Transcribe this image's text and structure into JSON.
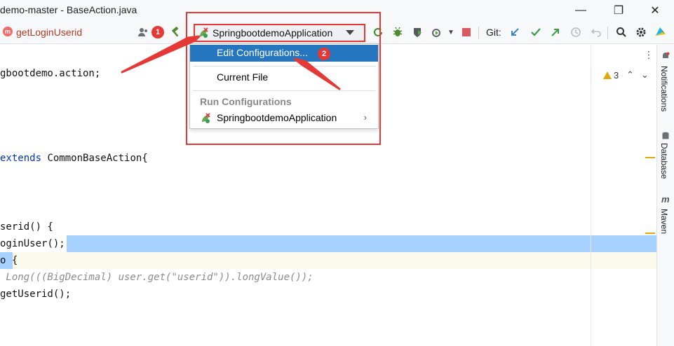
{
  "window": {
    "title": "demo-master - BaseAction.java",
    "min_glyph": "—",
    "restore_glyph": "❐",
    "close_glyph": "✕"
  },
  "toolbar": {
    "method_badge": "m",
    "method_label": "getLoginUserid",
    "run_config_label": "SpringbootdemoApplication",
    "git_label": "Git:"
  },
  "icons": {
    "user": "user-icon",
    "hammer": "hammer-icon",
    "app": "spring-app-icon",
    "rerun": "rerun-icon",
    "debug": "debug-icon",
    "coverage": "coverage-icon",
    "profile": "profile-icon",
    "more": "chevron-down-icon",
    "stop": "stop-icon",
    "git_update": "git-update-icon",
    "git_commit": "git-commit-icon",
    "git_push": "git-push-icon",
    "history": "history-icon",
    "rollback": "rollback-icon",
    "search": "search-icon",
    "settings": "gear-icon",
    "plugin": "plugin-icon"
  },
  "annotations": {
    "badge1": "1",
    "badge2": "2"
  },
  "dropdown": {
    "edit_configurations": "Edit Configurations...",
    "current_file": "Current File",
    "section_header": "Run Configurations",
    "config_item": "SpringbootdemoApplication",
    "submenu_glyph": "›"
  },
  "editor": {
    "lines": [
      {
        "plain": "gbootdemo.action;"
      },
      {
        "kw": "extends",
        "rest": " CommonBaseAction{"
      },
      {
        "plain": "serid() {"
      },
      {
        "plain": "oginUser();"
      },
      {
        "plain": "o {"
      },
      {
        "comment": " Long(((BigDecimal) user.get(\"userid\")).longValue());"
      },
      {
        "plain": "getUserid();"
      }
    ],
    "warning_count": "3",
    "up_glyph": "⌃",
    "down_glyph": "⌄",
    "kebab": "⋮"
  },
  "right_strip": {
    "notifications": "Notifications",
    "database": "Database",
    "maven": "Maven",
    "maven_icon_glyph": "m"
  },
  "colors": {
    "accent_selection": "#2675bf",
    "annotation_red": "#e53935",
    "text_selection": "#a6d1ff"
  }
}
